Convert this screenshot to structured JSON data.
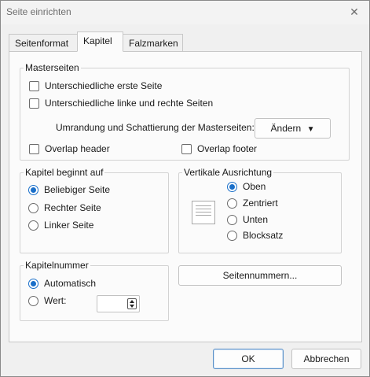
{
  "window": {
    "title": "Seite einrichten"
  },
  "tabs": [
    {
      "label": "Seitenformat",
      "active": false
    },
    {
      "label": "Kapitel",
      "active": true
    },
    {
      "label": "Falzmarken",
      "active": false
    }
  ],
  "masterseiten": {
    "legend": "Masterseiten",
    "first_page_label": "Unterschiedliche erste Seite",
    "first_page_checked": false,
    "left_right_label": "Unterschiedliche linke und rechte Seiten",
    "left_right_checked": false,
    "border_label": "Umrandung und Schattierung der Masterseiten:",
    "change_button": "Ändern",
    "overlap_header_label": "Overlap header",
    "overlap_header_checked": false,
    "overlap_footer_label": "Overlap footer",
    "overlap_footer_checked": false
  },
  "kapitel_start": {
    "legend": "Kapitel beginnt auf",
    "options": [
      "Beliebiger Seite",
      "Rechter Seite",
      "Linker Seite"
    ],
    "selected": "Beliebiger Seite"
  },
  "vertical_alignment": {
    "legend": "Vertikale Ausrichtung",
    "options": [
      "Oben",
      "Zentriert",
      "Unten",
      "Blocksatz"
    ],
    "selected": "Oben"
  },
  "kapitelnummer": {
    "legend": "Kapitelnummer",
    "auto_label": "Automatisch",
    "value_label": "Wert:",
    "selected": "Automatisch",
    "value": ""
  },
  "page_numbers_button": "Seitennummern...",
  "footer": {
    "ok": "OK",
    "cancel": "Abbrechen"
  },
  "colors": {
    "accent": "#1a6fc9",
    "background": "#f0f0f0",
    "panel": "#fbfbfb"
  },
  "icons": {
    "close": "close-icon",
    "dropdown": "triangle-down-icon",
    "page_preview": "page-preview-icon",
    "spinner": "spinner-arrows-icon"
  }
}
